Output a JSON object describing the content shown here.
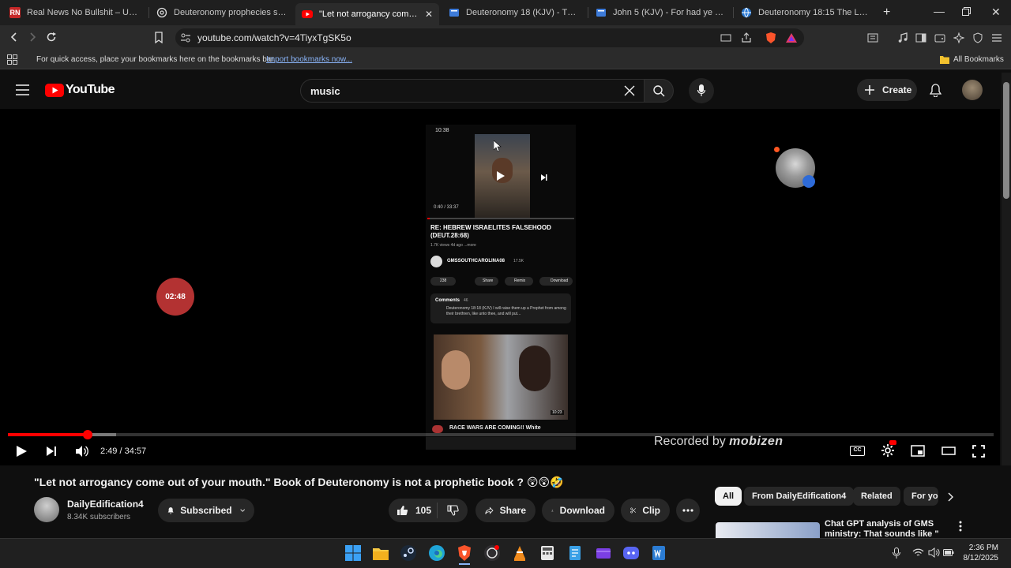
{
  "browser": {
    "tabs": [
      {
        "title": "Real News No Bullshit – Unbiased",
        "active": false
      },
      {
        "title": "Deuteronomy prophecies summa",
        "active": false
      },
      {
        "title": "\"Let not arrogancy come out",
        "active": true
      },
      {
        "title": "Deuteronomy 18 (KJV) - The pries",
        "active": false
      },
      {
        "title": "John 5 (KJV) - For had ye believed",
        "active": false
      },
      {
        "title": "Deuteronomy 18:15 The LORD yo",
        "active": false
      }
    ],
    "url": "youtube.com/watch?v=4TiyxTgSK5o",
    "bookmarks_text": "For quick access, place your bookmarks here on the bookmarks bar.",
    "bookmarks_link": "Import bookmarks now...",
    "all_bookmarks": "All Bookmarks"
  },
  "youtube": {
    "logo": "YouTube",
    "search_value": "music",
    "create_label": "Create"
  },
  "player": {
    "time_current": "2:49",
    "time_total": "34:57",
    "progress": 0.0806,
    "buffered": 0.11,
    "recorded_by": "Recorded by",
    "watermark_brand": "mobizen",
    "timer_badge": "02:48",
    "phone": {
      "status_time": "10:38",
      "mini_time": "0:40 / 33:37",
      "video_title": "RE: HEBREW ISRAELITES FALSEHOOD (DEUT.28:68)",
      "meta": "1.7K views  4d ago  ...more",
      "channel": "GMSSOUTHCAROLINA08",
      "subs": "17.5K",
      "likes": "238",
      "share": "Share",
      "remix": "Remix",
      "download": "Download",
      "comments_label": "Comments",
      "comments_count": "46",
      "comment_text": "Deuteronomy 18:18 (KJV) I will raise them up a Prophet from among their brethren, like unto thee, and will put...",
      "thumb_duration": "10:23",
      "next_title": "RACE WARS ARE COMING!! White"
    }
  },
  "video": {
    "title": "\"Let not arrogancy come out of your mouth.\" Book of Deuteronomy is not a prophetic book ? 😲😲🤣",
    "channel": "DailyEdification4",
    "subscribers": "8.34K subscribers",
    "subscribed_label": "Subscribed",
    "likes": "105",
    "share_label": "Share",
    "download_label": "Download",
    "clip_label": "Clip"
  },
  "sidebar": {
    "chips": [
      "All",
      "From DailyEdification4",
      "Related",
      "For yo"
    ],
    "rec_title": "Chat GPT analysis of GMS ministry: That sounds like \""
  },
  "taskbar": {
    "time": "2:36 PM",
    "date": "8/12/2025"
  },
  "colors": {
    "accent_red": "#ff0000",
    "bg": "#0f0f0f",
    "chip_active_bg": "#f1f1f1"
  }
}
